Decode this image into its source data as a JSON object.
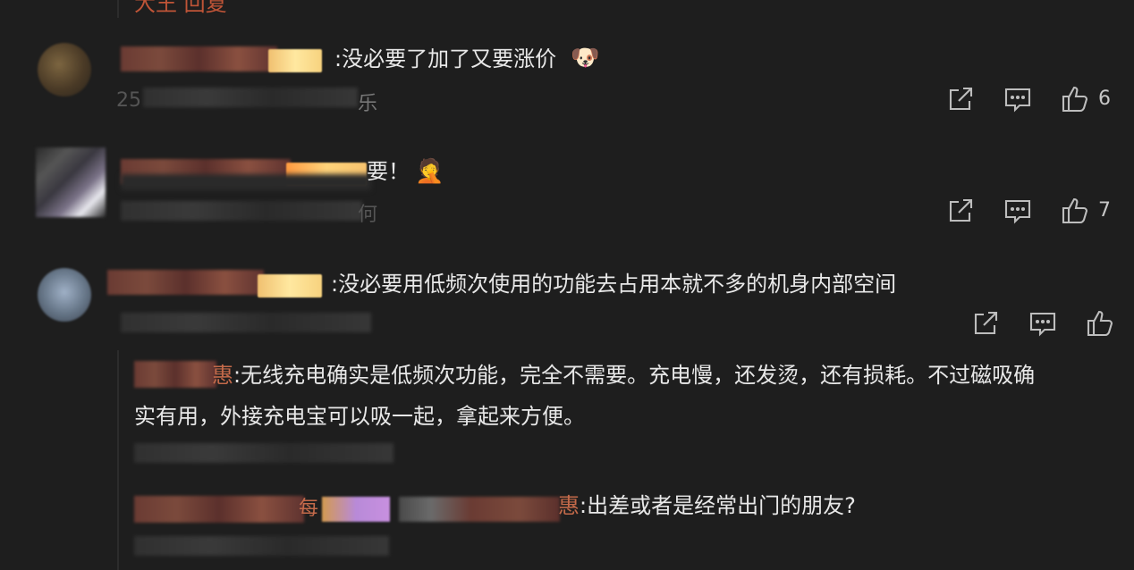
{
  "top_fragment": "大王 回复",
  "comments": [
    {
      "text": ":没必要了加了又要涨价",
      "emoji": "🐶",
      "meta_partial": "25",
      "meta_tail": "乐",
      "like_count": "6"
    },
    {
      "text": "要！",
      "emoji": "🤦",
      "meta_tail": "何",
      "like_count": "7"
    },
    {
      "text": ":没必要用低频次使用的功能去占用本就不多的机身内部空间",
      "replies": [
        {
          "name_tail": "惠",
          "text_line1": ":无线充电确实是低频次功能，完全不需要。充电慢，还发烫，还有损耗。不过磁吸确",
          "text_line2": "实有用，外接充电宝可以吸一起，拿起来方便。"
        },
        {
          "name_mid": "每",
          "name_tail": "惠",
          "text": ":出差或者是经常出门的朋友?"
        }
      ]
    }
  ],
  "colors": {
    "background": "#1e1e1e",
    "text": "#e8e8e8",
    "icon": "#bdbdbd",
    "top_fragment": "#d15a3a"
  },
  "icons": [
    "share-icon",
    "comment-icon",
    "like-icon"
  ]
}
